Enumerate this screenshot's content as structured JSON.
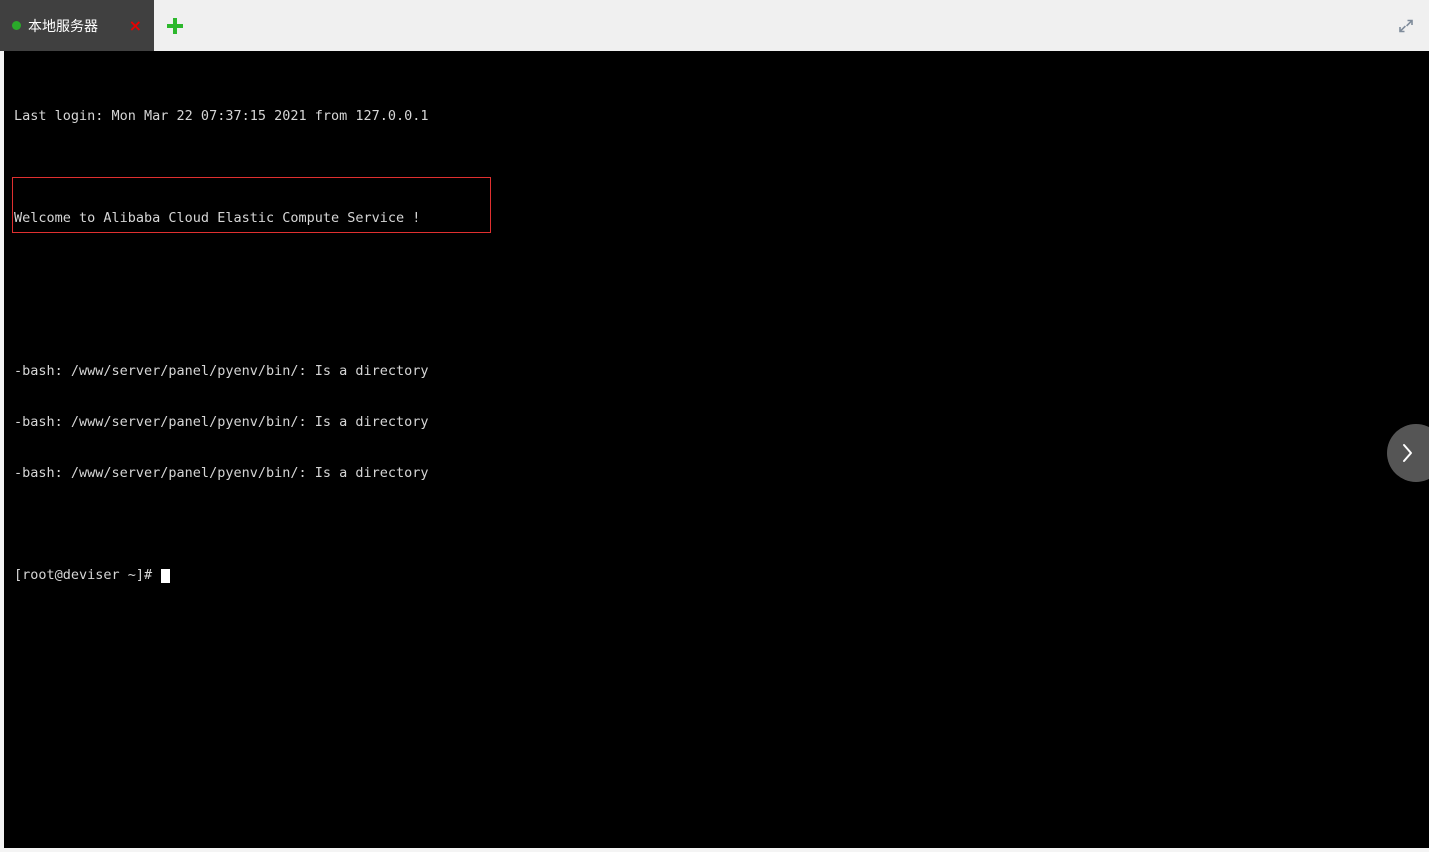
{
  "window": {
    "tab": {
      "title": "本地服务器",
      "status_dot_color": "#2aa92a",
      "close_label": "×",
      "close_icon": "close-icon"
    },
    "new_tab_icon": "plus-icon",
    "expand_icon": "expand-fullscreen-icon",
    "slide_handle_icon": "chevron-right-icon",
    "colors": {
      "tab_active_bg": "#404040",
      "tabbar_bg": "#f0f0f0",
      "terminal_bg": "#000000",
      "terminal_fg": "#d6d6d6",
      "accent_green": "#2db82d",
      "accent_red": "#e80000",
      "annotation_red": "#e03030"
    }
  },
  "terminal": {
    "lines": [
      "Last login: Mon Mar 22 07:37:15 2021 from 127.0.0.1",
      "",
      "Welcome to Alibaba Cloud Elastic Compute Service !",
      ""
    ],
    "errors": [
      "-bash: /www/server/panel/pyenv/bin/: Is a directory",
      "-bash: /www/server/panel/pyenv/bin/: Is a directory",
      "-bash: /www/server/panel/pyenv/bin/: Is a directory"
    ],
    "prompt": "[root@deviser ~]#",
    "cursor": "block-cursor"
  }
}
